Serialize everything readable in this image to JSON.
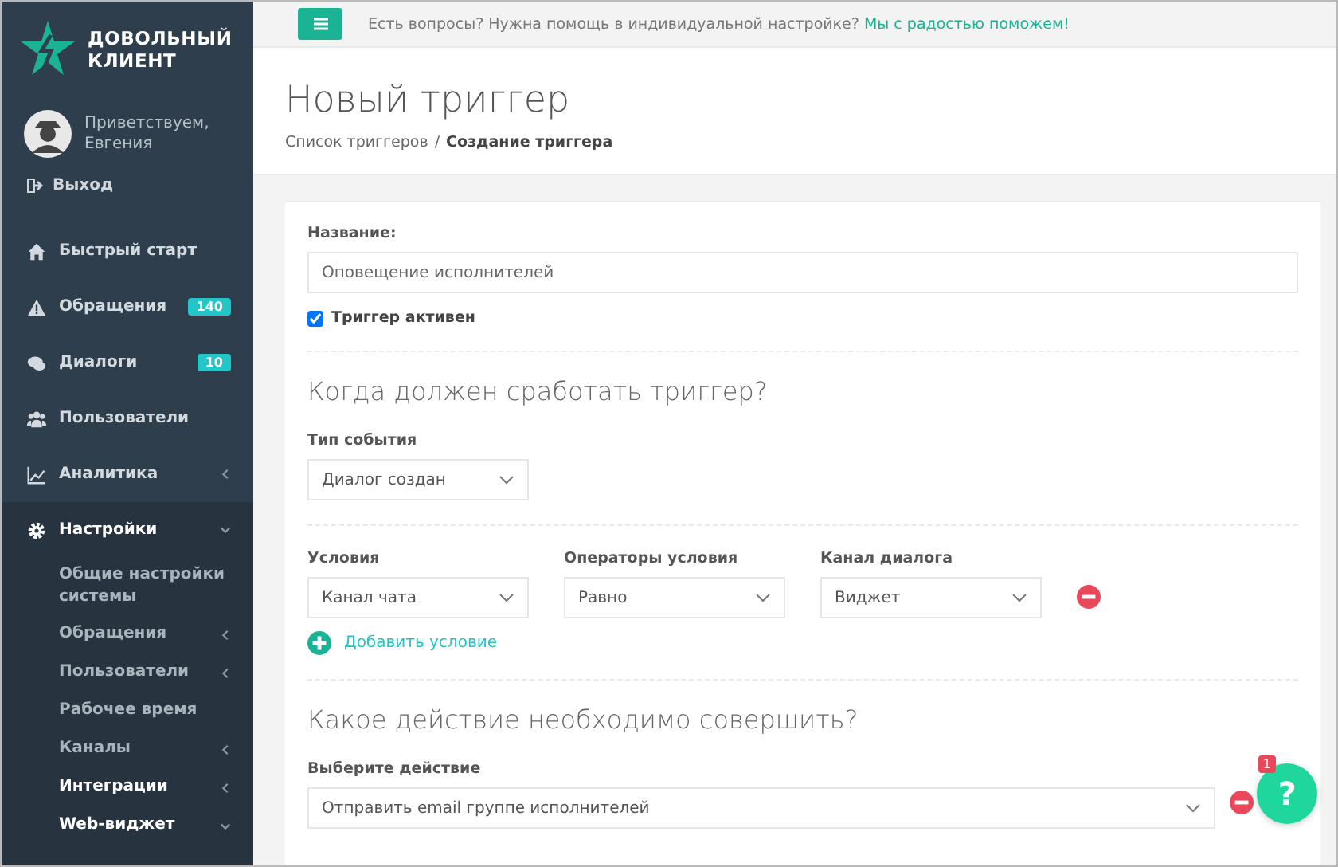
{
  "logo": {
    "line1": "ДОВОЛЬНЫЙ",
    "line2": "КЛИЕНТ"
  },
  "user": {
    "greeting": "Приветствуем,",
    "name": "Евгения"
  },
  "logout": {
    "label": "Выход"
  },
  "nav": [
    {
      "label": "Быстрый старт"
    },
    {
      "label": "Обращения",
      "badge": "140"
    },
    {
      "label": "Диалоги",
      "badge": "10"
    },
    {
      "label": "Пользователи"
    },
    {
      "label": "Аналитика",
      "expanded": false
    },
    {
      "label": "Настройки",
      "expanded": true,
      "children": [
        {
          "label": "Общие настройки системы",
          "selected": false
        },
        {
          "label": "Обращения",
          "selected": false,
          "expanded": false
        },
        {
          "label": "Пользователи",
          "selected": false,
          "expanded": false
        },
        {
          "label": "Рабочее время",
          "selected": false
        },
        {
          "label": "Каналы",
          "selected": false,
          "expanded": false
        },
        {
          "label": "Интеграции",
          "selected": true,
          "expanded": false
        },
        {
          "label": "Web-виджет",
          "selected": true,
          "expanded": true
        }
      ]
    }
  ],
  "topbar": {
    "question": "Есть вопросы? Нужна помощь в индивидуальной настройке?",
    "link": "Мы с радостью поможем!"
  },
  "page": {
    "title": "Новый триггер",
    "separator": "/",
    "breadcrumbs": [
      {
        "label": "Список триггеров",
        "selected": false
      },
      {
        "label": "Создание триггера",
        "selected": true
      }
    ]
  },
  "form": {
    "name_label": "Название:",
    "name_value": "Оповещение исполнителей",
    "active_label": "Триггер активен",
    "active": true,
    "section1": "Когда должен сработать триггер?",
    "event_label": "Тип события",
    "event_value": "Диалог создан",
    "conditions": [
      {
        "label": "Условия",
        "value": "Канал чата"
      },
      {
        "label": "Операторы условия",
        "value": "Равно"
      },
      {
        "label": "Канал диалога",
        "value": "Виджет"
      }
    ],
    "add_condition": "Добавить условие",
    "section2": "Какое действие необходимо совершить?",
    "action_label": "Выберите действие",
    "action_value": "Отправить email группе исполнителей"
  },
  "help": {
    "label": "?",
    "badge": "1"
  }
}
